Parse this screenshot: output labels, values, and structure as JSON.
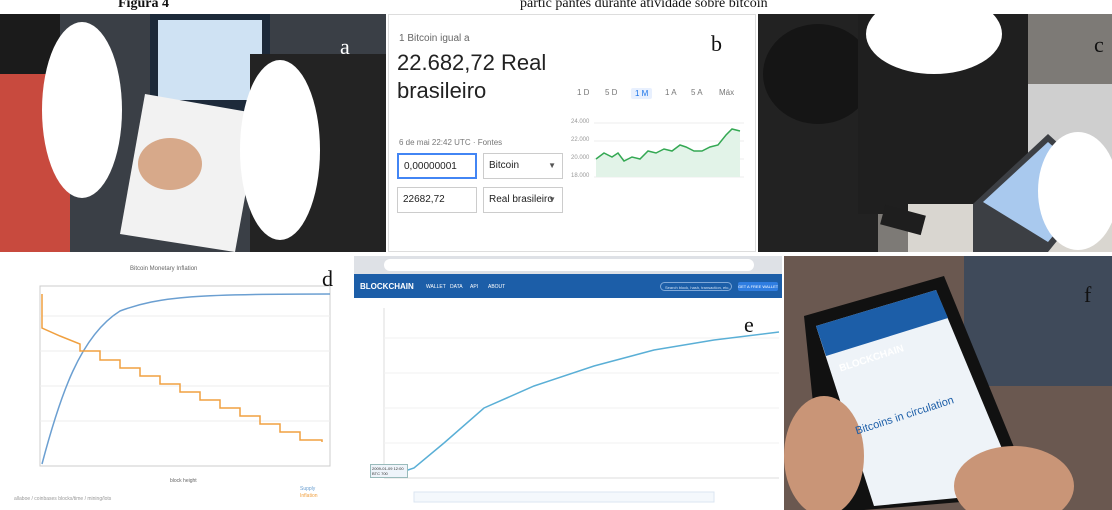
{
  "caption": {
    "left": "Figura 4",
    "right": "partic pantes durante atividade sobre bitcoin"
  },
  "panel_labels": [
    "a",
    "b",
    "c",
    "d",
    "e",
    "f"
  ],
  "converter": {
    "equals_label": "1 Bitcoin igual a",
    "amount": "22.682,72 Real brasileiro",
    "date": "6 de mai 22:42 UTC · Fontes",
    "input_from": "0,00000001",
    "currency_from": "Bitcoin",
    "input_to": "22682,72",
    "currency_to": "Real brasileiro",
    "ranges": [
      "1 D",
      "5 D",
      "1 M",
      "1 A",
      "5 A",
      "Máx"
    ],
    "selected_range": "1 M",
    "y_ticks": [
      "24.000",
      "22.000",
      "20.000",
      "18.000"
    ],
    "accent": "#1a73e8"
  },
  "inflation_chart": {
    "title": "Bitcoin Monetary Inflation",
    "xlabel": "block height",
    "legend": [
      "Supply",
      "Inflation"
    ],
    "source": "allaboe / coinbases blocks/time / mining/lots",
    "colors": {
      "supply": "#6b9fd1",
      "inflation": "#f0a040"
    }
  },
  "blockchain_site": {
    "logo": "BLOCKCHAIN",
    "nav": [
      "WALLET",
      "DATA",
      "API",
      "ABOUT"
    ],
    "search_placeholder": "Search block, hash, transaction, etc...",
    "cta": "GET A FREE WALLET",
    "tooltip": "2009-01-09 12:00 BTC 700",
    "brand_color": "#1c5ea8"
  },
  "phone": {
    "logo": "BLOCKCHAIN",
    "heading": "Bitcoins in circulation"
  }
}
